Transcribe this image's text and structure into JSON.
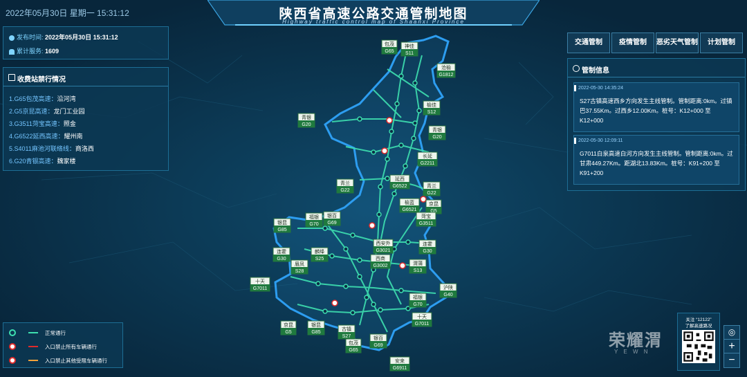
{
  "header": {
    "datetime": "2022年05月30日 星期一   15:31:12",
    "title": "陕西省高速公路交通管制地图",
    "subtitle": "Highway traffic control map of Shaanxi Province"
  },
  "info": {
    "publish_label": "发布时间:",
    "publish_value": "2022年05月30日 15:31:12",
    "visits_label": "累计服务:",
    "visits_value": "1609"
  },
  "toll": {
    "title": "收费站禁行情况",
    "items": [
      {
        "road": "1.G65包茂高速：",
        "station": "沿河湾"
      },
      {
        "road": "2.G5京昆高速：",
        "station": "龙门工业园"
      },
      {
        "road": "3.G3511菏宝高速：",
        "station": "照金"
      },
      {
        "road": "4.G6522延西高速：",
        "station": "耀州南"
      },
      {
        "road": "5.S4011麻池河联络线：",
        "station": "商洛西"
      },
      {
        "road": "6.G20青银高速：",
        "station": "魏家楼"
      }
    ]
  },
  "tabs": [
    "交通管制",
    "疫情管制",
    "恶劣天气管制",
    "计划管制"
  ],
  "control": {
    "title": "管制信息",
    "messages": [
      {
        "time": "2022-05-30 14:35:24",
        "text": "S27古镇高速西乡方向发生主线管制。管制距离:0km。过镇巴37.55Km。过西乡12.00Km。桩号：K12+000 至 K12+000"
      },
      {
        "time": "2022-05-30 12:09:11",
        "text": "G7011白泉高速白河方向发生主线管制。管制距离:0km。过甘肃449.27Km。距湖北13.83Km。桩号：K91+200 至 K91+200"
      }
    ]
  },
  "legend": [
    {
      "label": "正常通行",
      "color": "#3ee0b0"
    },
    {
      "label": "入口禁止所有车辆通行",
      "color": "#e02b2b"
    },
    {
      "label": "入口禁止其他受限车辆通行",
      "color": "#f2a23a"
    }
  ],
  "map_labels": [
    {
      "name": "包茂",
      "code": "G65"
    },
    {
      "name": "神佳",
      "code": "S11"
    },
    {
      "name": "沧榆",
      "code": "G1812"
    },
    {
      "name": "榆佳",
      "code": "S12"
    },
    {
      "name": "青银",
      "code": "G20"
    },
    {
      "name": "青银",
      "code": "G20"
    },
    {
      "name": "长延",
      "code": "G2211"
    },
    {
      "name": "青兰",
      "code": "G22"
    },
    {
      "name": "延西",
      "code": "G6522"
    },
    {
      "name": "青兰",
      "code": "G22"
    },
    {
      "name": "榆蓝",
      "code": "G6521"
    },
    {
      "name": "京昆",
      "code": "G5"
    },
    {
      "name": "福银",
      "code": "G70"
    },
    {
      "name": "银百",
      "code": "G69"
    },
    {
      "name": "银昆",
      "code": "G85"
    },
    {
      "name": "菏宝",
      "code": "G3511"
    },
    {
      "name": "西安外",
      "code": "G3021"
    },
    {
      "name": "连霍",
      "code": "G30"
    },
    {
      "name": "连霍",
      "code": "G30"
    },
    {
      "name": "麟绛",
      "code": "S25"
    },
    {
      "name": "西商",
      "code": "G3002"
    },
    {
      "name": "眉凤",
      "code": "S28"
    },
    {
      "name": "渭蒲",
      "code": "S13"
    },
    {
      "name": "十天",
      "code": "G7011"
    },
    {
      "name": "沪陕",
      "code": "G40"
    },
    {
      "name": "福银",
      "code": "G70"
    },
    {
      "name": "十天",
      "code": "G7011"
    },
    {
      "name": "京昆",
      "code": "G5"
    },
    {
      "name": "银昆",
      "code": "G85"
    },
    {
      "name": "古镇",
      "code": "S27"
    },
    {
      "name": "包茂",
      "code": "G65"
    },
    {
      "name": "银百",
      "code": "G69"
    },
    {
      "name": "安来",
      "code": "G6911"
    }
  ],
  "qr": {
    "line1": "关注 “12122”",
    "line2": "了解高速路况"
  },
  "watermark": {
    "brand": "荣耀渭",
    "url": "Y E W N"
  },
  "zoom": {
    "plus": "+",
    "minus": "−"
  }
}
